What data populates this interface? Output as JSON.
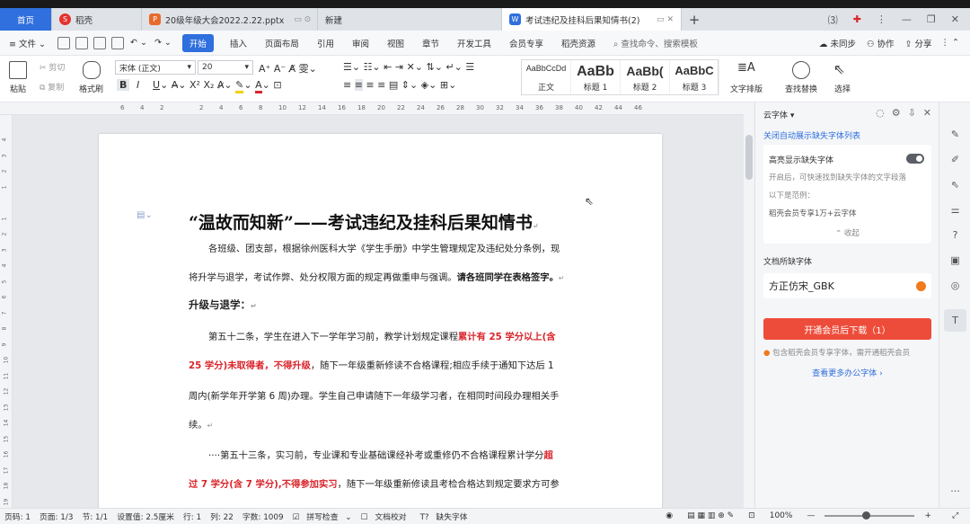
{
  "tabs": [
    {
      "label": "首页",
      "type": "home"
    },
    {
      "label": "稻壳",
      "icon": "daoke-icon"
    },
    {
      "label": "20级年级大会2022.2.22.pptx",
      "icon": "ppt-icon"
    },
    {
      "label": "新建"
    },
    {
      "label": "考试违纪及挂科后果知情书(2)",
      "icon": "word-icon",
      "active": true
    }
  ],
  "menu": {
    "file": "文件",
    "start": "开始",
    "items": [
      "插入",
      "页面布局",
      "引用",
      "审阅",
      "视图",
      "章节",
      "开发工具",
      "会员专享",
      "稻壳资源"
    ],
    "search": "查找命令、搜索模板",
    "unsynced": "未同步",
    "collab": "协作",
    "share": "分享"
  },
  "ribbon": {
    "paste": "粘贴",
    "cut": "剪切",
    "copy": "复制",
    "format_painter": "格式刷",
    "font_name": "宋体 (正文)",
    "font_size": "20",
    "styles": [
      {
        "sample": "AaBbCcDd",
        "name": "正文"
      },
      {
        "sample": "AaBb",
        "name": "标题 1"
      },
      {
        "sample": "AaBb(",
        "name": "标题 2"
      },
      {
        "sample": "AaBbC",
        "name": "标题 3"
      }
    ],
    "text_layout": "文字排版",
    "find_replace": "查找替换",
    "select": "选择"
  },
  "ruler_ticks": [
    "6",
    "4",
    "2",
    "",
    "2",
    "4",
    "6",
    "8",
    "10",
    "12",
    "14",
    "16",
    "18",
    "20",
    "22",
    "24",
    "26",
    "28",
    "30",
    "32",
    "34",
    "36",
    "38",
    "40",
    "42",
    "44",
    "46"
  ],
  "vruler_ticks": [
    "4",
    "3",
    "2",
    "1",
    "",
    "1",
    "2",
    "3",
    "4",
    "5",
    "6",
    "7",
    "8",
    "9",
    "10",
    "11",
    "12",
    "13",
    "14",
    "15",
    "16",
    "17",
    "18",
    "19"
  ],
  "doc": {
    "title": "“温故而知新”——考试违纪及挂科后果知情书",
    "p1a": "各班级、团支部，根据徐州医科大学《学生手册》中学生管理规定及违纪处分条例，现",
    "p1b": "将升学与退学，考试作弊、处分权限方面的规定再做重申与强调。",
    "p1b_bold": "请各班同学在表格签字。",
    "h1": "升级与退学：",
    "p2a_pre": "第五十二条，学生在进入下一学年学习前，教学计划规定课程",
    "p2a_red": "累计有 25 学分以上(含",
    "p2b_red": "25 学分)未取得者，不得升级",
    "p2b_post": "，随下一年级重新修读不合格课程;相应手续于通知下达后 1",
    "p2c": "周内(新学年开学第 6 周)办理。学生自己申请随下一年级学习者，在相同时间段办理相关手",
    "p2d": "续。",
    "p3a_pre": "····第五十三条，实习前，专业课和专业基础课经补考或重修仍不合格课程累计学分",
    "p3a_red": "超",
    "p3b_red": "过 7 学分(含 7 学分),不得参加实习",
    "p3b_post": "，随下一年级重新修读且考检合格达到规定要求方可参"
  },
  "panel": {
    "title": "云字体",
    "close_link": "关闭自动展示缺失字体列表",
    "highlight_label": "高亮显示缺失字体",
    "highlight_desc": "开启后，可快速找到缺失字体的文字段落",
    "example_label": "以下是范例：",
    "example": "稻壳会员专享1万+云字体",
    "collapse": "收起",
    "missing_title": "文档所缺字体",
    "missing_font": "方正仿宋_GBK",
    "download": "开通会员后下载（1）",
    "note": "包含稻壳会员专享字体，需开通稻壳会员",
    "more": "查看更多办公字体"
  },
  "status": {
    "items": [
      "页码: 1",
      "页面: 1/3",
      "节: 1/1",
      "设置值: 2.5厘米",
      "行: 1",
      "列: 22",
      "字数: 1009"
    ],
    "spell": "拼写检查",
    "proof": "文档校对",
    "missing": "缺失字体",
    "zoom": "100%"
  }
}
